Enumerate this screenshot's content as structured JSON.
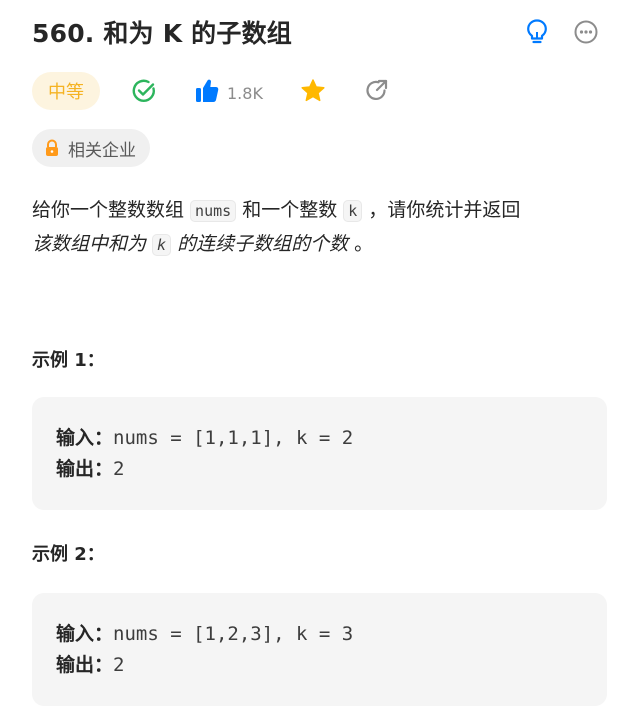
{
  "problem": {
    "title": "560. 和为 K 的子数组",
    "difficulty": "中等",
    "likes": "1.8K",
    "company_label": "相关企业"
  },
  "icons": {
    "hint": "lightbulb-icon",
    "more": "more-icon",
    "solved": "check-circle-icon",
    "like": "thumbs-up-icon",
    "favorite": "star-icon",
    "share": "share-icon",
    "lock": "lock-icon"
  },
  "colors": {
    "accent_blue": "#007aff",
    "difficulty_bg": "#fdf4df",
    "difficulty_text": "#f5b323",
    "solved_green": "#2db55d",
    "star_yellow": "#ffb800",
    "lock_orange": "#ff9a1a"
  },
  "description": {
    "part1": "给你一个整数数组 ",
    "code1": "nums",
    "part2": " 和一个整数 ",
    "code2": "k",
    "part3": " ，请你统计并返回",
    "part4": "该数组中和为 ",
    "code3": "k",
    "part5": " 的连续子数组的个数",
    "part6": " 。"
  },
  "examples": [
    {
      "title": "示例 1：",
      "input_label": "输入：",
      "input": "nums = [1,1,1], k = 2",
      "output_label": "输出：",
      "output": "2"
    },
    {
      "title": "示例 2：",
      "input_label": "输入：",
      "input": "nums = [1,2,3], k = 3",
      "output_label": "输出：",
      "output": "2"
    }
  ]
}
